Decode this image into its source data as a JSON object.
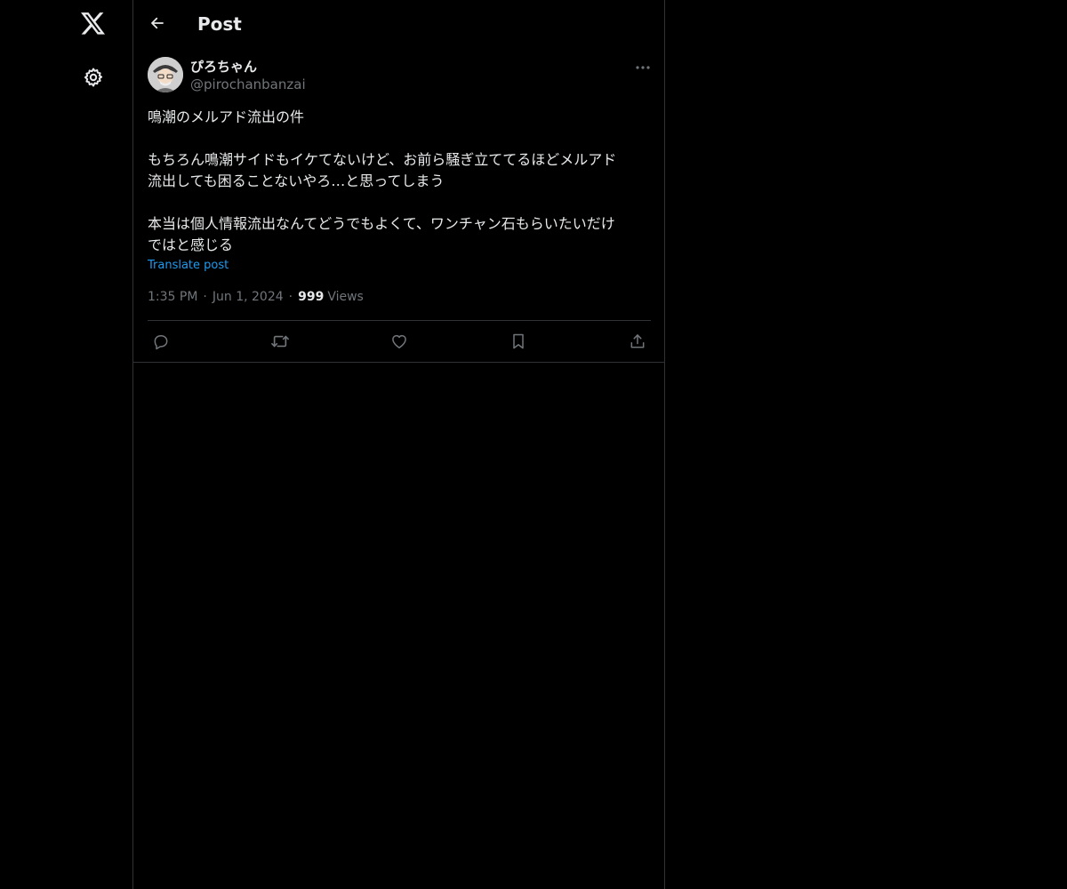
{
  "header": {
    "title": "Post"
  },
  "sidebar": {
    "icons": [
      "x-logo",
      "gear-icon"
    ]
  },
  "post": {
    "author": {
      "display_name": "ぴろちゃん",
      "handle": "@pirochanbanzai"
    },
    "text": {
      "line1": "鳴潮のメルアド流出の件",
      "para2_line1": "もちろん鳴潮サイドもイケてないけど、お前ら騒ぎ立ててるほどメルアド",
      "para2_line2": "流出しても困ることないやろ…と思ってしまう",
      "para3_line1": "本当は個人情報流出なんてどうでもよくて、ワンチャン石もらいたいだけ",
      "para3_line2": "ではと感じる"
    },
    "translate_label": "Translate post",
    "time": "1:35 PM",
    "date": "Jun 1, 2024",
    "views_count": "999",
    "views_label": "Views",
    "separator": "·",
    "actions": [
      "reply-icon",
      "repost-icon",
      "like-icon",
      "bookmark-icon",
      "share-icon"
    ]
  },
  "colors": {
    "background": "#000000",
    "text": "#e7e9ea",
    "secondary": "#71767b",
    "link": "#1d9bf0",
    "border": "#2f3336"
  }
}
